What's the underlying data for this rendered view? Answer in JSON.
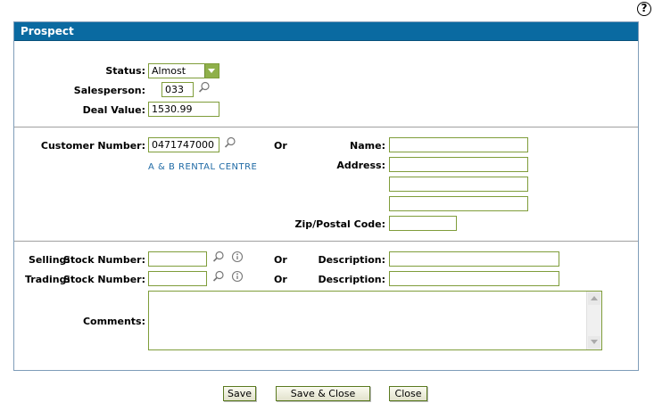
{
  "help_label": "?",
  "panel": {
    "title": "Prospect"
  },
  "deal": {
    "status_label": "Status:",
    "status_value": "Almost",
    "salesperson_label": "Salesperson:",
    "salesperson_value": "033",
    "deal_value_label": "Deal Value:",
    "deal_value_value": "1530.99"
  },
  "customer": {
    "customer_number_label": "Customer Number:",
    "customer_number_value": "0471747000",
    "customer_name_link": "A & B RENTAL CENTRE",
    "or_label": "Or",
    "name_label": "Name:",
    "address_label": "Address:",
    "zip_label": "Zip/Postal Code:"
  },
  "stock": {
    "selling_label": "Selling:",
    "trading_label": "Trading:",
    "stock_number_label": "Stock Number:",
    "or_label": "Or",
    "description_label": "Description:",
    "comments_label": "Comments:"
  },
  "buttons": {
    "save": "Save",
    "save_close": "Save & Close",
    "close": "Close"
  }
}
